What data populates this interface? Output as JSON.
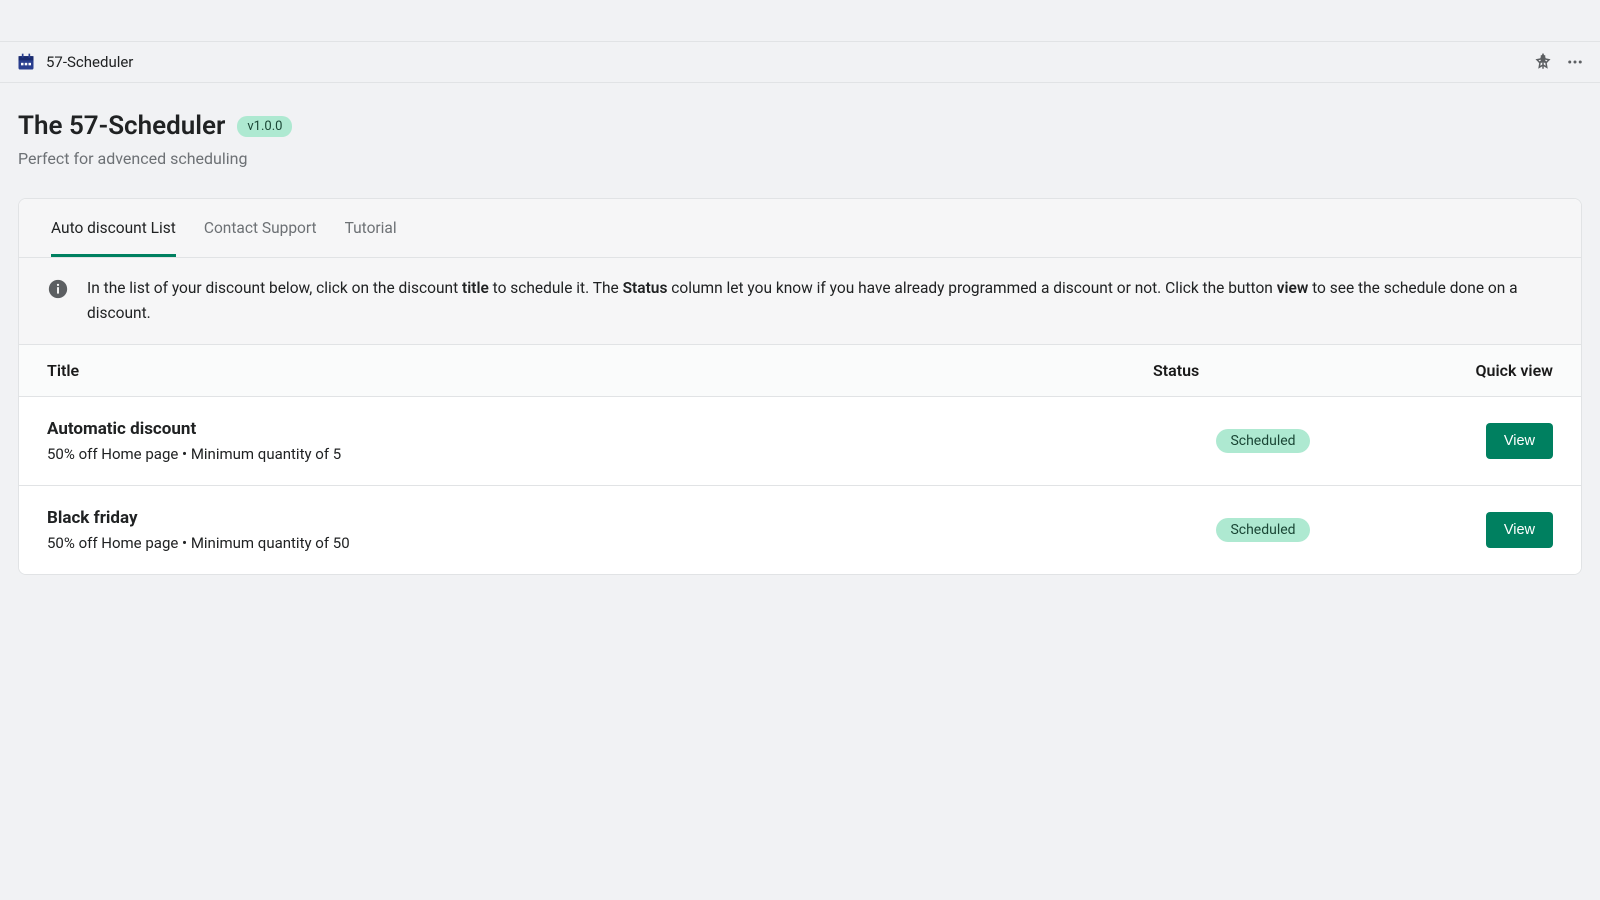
{
  "appbar": {
    "name": "57-Scheduler"
  },
  "header": {
    "title": "The 57-Scheduler",
    "version": "v1.0.0",
    "subtitle": "Perfect for advenced scheduling"
  },
  "tabs": [
    {
      "label": "Auto discount List",
      "active": true
    },
    {
      "label": "Contact Support",
      "active": false
    },
    {
      "label": "Tutorial",
      "active": false
    }
  ],
  "banner": {
    "pre": "In the list of your discount below, click on the discount ",
    "b1": "title",
    "mid1": " to schedule it. The ",
    "b2": "Status",
    "mid2": " column let you know if you have already programmed a discount or not. Click the button ",
    "b3": "view",
    "post": " to see the schedule done on a discount."
  },
  "table": {
    "headers": {
      "title": "Title",
      "status": "Status",
      "quick": "Quick view"
    },
    "rows": [
      {
        "title": "Automatic discount",
        "subtitle": "50% off Home page • Minimum quantity of 5",
        "status": "Scheduled",
        "action": "View"
      },
      {
        "title": "Black friday",
        "subtitle": "50% off Home page • Minimum quantity of 50",
        "status": "Scheduled",
        "action": "View"
      }
    ]
  }
}
